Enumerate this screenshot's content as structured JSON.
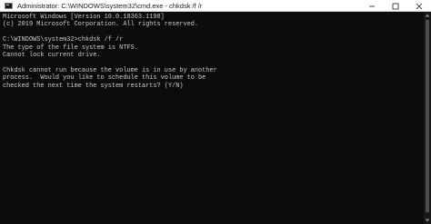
{
  "window": {
    "title": "Administrator: C:\\WINDOWS\\system32\\cmd.exe - chkdsk  /f /r"
  },
  "caption_buttons": [
    "minimize-icon",
    "maximize-icon",
    "close-icon"
  ],
  "console": {
    "lines": [
      "Microsoft Windows [Version 10.0.18363.1198]",
      "(c) 2019 Microsoft Corporation. All rights reserved.",
      "",
      "C:\\WINDOWS\\system32>chkdsk /f /r",
      "The type of the file system is NTFS.",
      "Cannot lock current drive.",
      "",
      "Chkdsk cannot run because the volume is in use by another",
      "process.  Would you like to schedule this volume to be",
      "checked the next time the system restarts? (Y/N)"
    ]
  },
  "colors": {
    "background": "#0c0c0c",
    "text": "#cccccc",
    "titlebar": "#ffffff"
  }
}
